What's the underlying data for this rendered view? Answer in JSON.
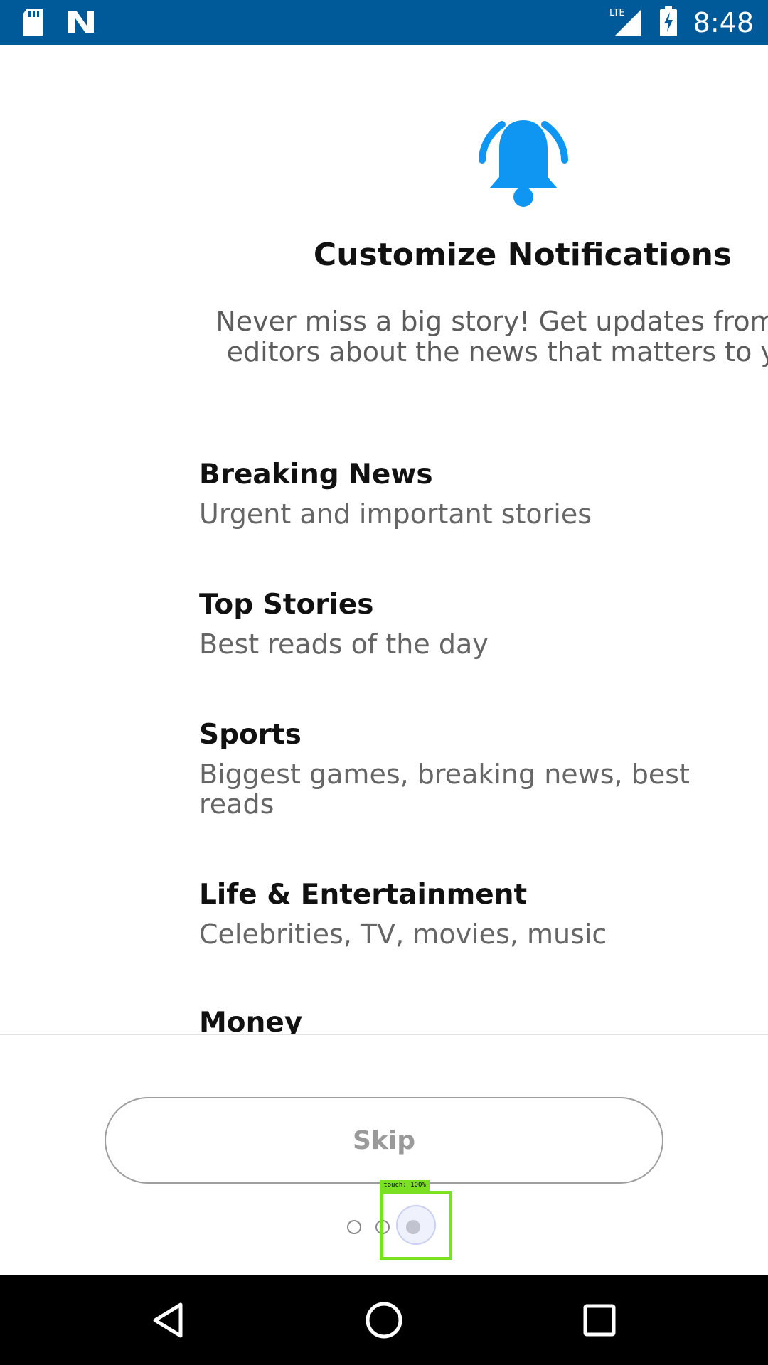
{
  "status_bar": {
    "time": "8:48",
    "network": "LTE",
    "icons": [
      "sd-card-icon",
      "n-logo-icon",
      "lte-signal-icon",
      "battery-charging-icon"
    ]
  },
  "header": {
    "icon": "bell-icon",
    "icon_color": "#0f96f2",
    "title": "Customize Notifications",
    "subtitle": "Never miss a big story! Get updates from our editors about the news that matters to you."
  },
  "options": [
    {
      "title": "Breaking News",
      "description": "Urgent and important stories"
    },
    {
      "title": "Top Stories",
      "description": "Best reads of the day"
    },
    {
      "title": "Sports",
      "description": "Biggest games, breaking news, best reads"
    },
    {
      "title": "Life & Entertainment",
      "description": "Celebrities, TV, movies, music"
    },
    {
      "title": "Money",
      "description": ""
    }
  ],
  "footer": {
    "skip_label": "Skip",
    "pager": {
      "count": 3,
      "active_index": 2
    },
    "touch_label": "touch: 100%"
  },
  "nav_bar": {
    "buttons": [
      "back-icon",
      "home-icon",
      "recents-icon"
    ]
  }
}
